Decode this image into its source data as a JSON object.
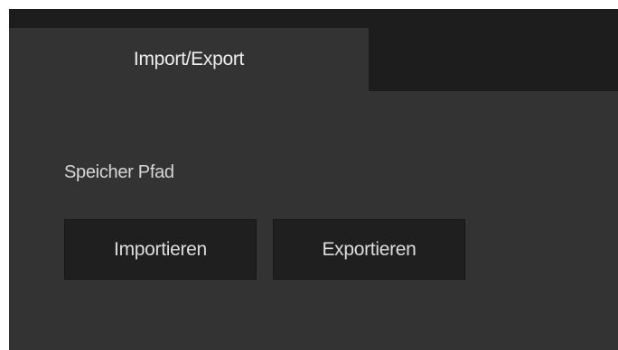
{
  "tabs": [
    {
      "label": "Import/Export",
      "active": true
    }
  ],
  "panel": {
    "path_label": "Speicher Pfad",
    "import_button": "Importieren",
    "export_button": "Exportieren"
  },
  "colors": {
    "window_background": "#1d1d1d",
    "panel_background": "#333333",
    "button_background": "#1f1f1f",
    "text": "#dddddd"
  }
}
